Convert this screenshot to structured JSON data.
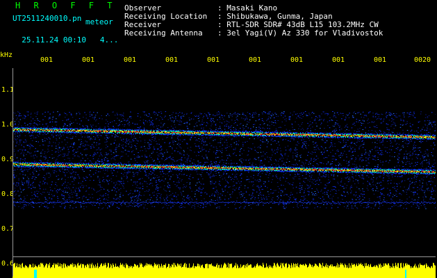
{
  "header": {
    "brand": "H R O F F T",
    "filename": "UT2511240010.pn",
    "meteor_label": "meteor",
    "datetime": "25.11.24 00:10",
    "count": "4..."
  },
  "info": [
    {
      "label": "Observer",
      "value": ": Masaki Kano"
    },
    {
      "label": "Receiving Location",
      "value": ": Shibukawa, Gunma, Japan"
    },
    {
      "label": "Receiver",
      "value": ": RTL-SDR SDR# 43dB L15 103.2MHz CW"
    },
    {
      "label": "Receiving Antenna",
      "value": ": 3el Yagi(V) Az 330 for Vladivostok"
    }
  ],
  "axis": {
    "unit": "kHz",
    "y_labels": [
      "1.1",
      "1.0",
      "0.9",
      "0.8",
      "0.7",
      "0.6"
    ],
    "time_labels": [
      "001",
      "001",
      "001",
      "001",
      "001",
      "001",
      "001",
      "001",
      "001",
      "0020"
    ]
  },
  "colors": {
    "text_green": "#00ff00",
    "text_cyan": "#00ffff",
    "text_white": "#ffffff",
    "axis_yellow": "#ffff00",
    "signal_red": "#ff3030",
    "noise_blue": "#1030ff",
    "signal_yellow": "#ffff00"
  }
}
